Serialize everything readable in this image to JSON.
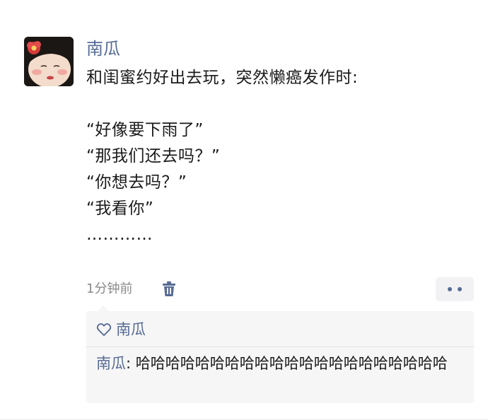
{
  "post": {
    "author": "南瓜",
    "lines": [
      "和闺蜜约好出去玩，突然懒癌发作时:",
      "",
      "“好像要下雨了”",
      "“那我们还去吗？”",
      "“你想去吗？”",
      "“我看你”",
      "…………"
    ],
    "timestamp": "1分钟前"
  },
  "likes": {
    "names": "南瓜"
  },
  "comments": [
    {
      "author": "南瓜",
      "separator": ": ",
      "text": "哈哈哈哈哈哈哈哈哈哈哈哈哈哈哈哈哈哈哈哈哈"
    }
  ],
  "icons": {
    "delete": "trash-icon",
    "more": "more-dots-icon",
    "like": "heart-outline-icon"
  },
  "colors": {
    "link": "#576b95",
    "timestamp": "#8a8a8a",
    "comment_bg": "#f6f6f6"
  }
}
